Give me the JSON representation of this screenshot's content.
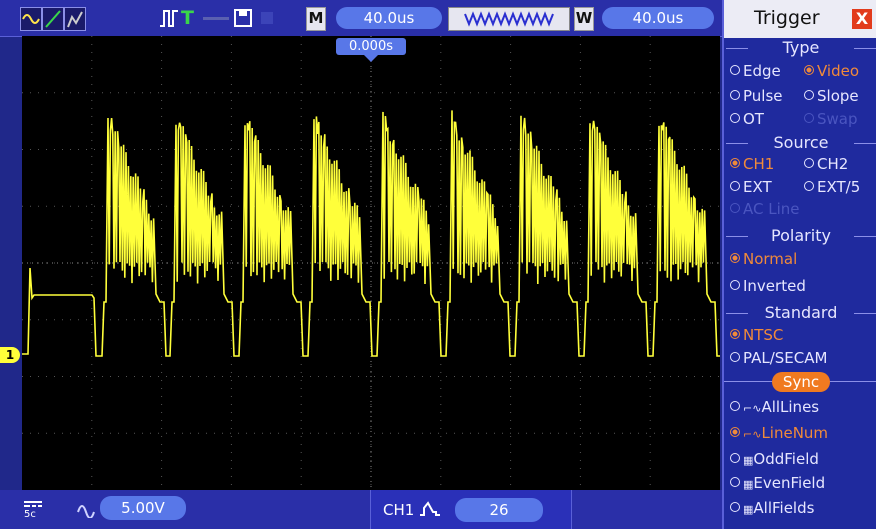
{
  "toolbar": {
    "timebase_label": "M",
    "timebase": "40.0us",
    "window_label": "W",
    "window": "40.0us"
  },
  "screen": {
    "trigger_time": "0.000s",
    "ch1_marker": "1"
  },
  "bottom": {
    "ch_volts": "5.00V",
    "trigger_channel": "CH1",
    "line_number": "26"
  },
  "menu": {
    "title": "Trigger",
    "close": "X",
    "type_title": "Type",
    "type": [
      "Edge",
      "Video",
      "Pulse",
      "Slope",
      "OT",
      "Swap"
    ],
    "source_title": "Source",
    "source": [
      "CH1",
      "CH2",
      "EXT",
      "EXT/5",
      "AC Line"
    ],
    "polarity_title": "Polarity",
    "polarity": [
      "Normal",
      "Inverted"
    ],
    "standard_title": "Standard",
    "standard": [
      "NTSC",
      "PAL/SECAM"
    ],
    "sync_title": "Sync",
    "sync": [
      "AllLines",
      "LineNum",
      "OddField",
      "EvenField",
      "AllFields"
    ]
  },
  "colors": {
    "trace": "#ffff3a",
    "screen": "#000000",
    "menu": "#1f2a9e",
    "selected": "#f08a3a"
  }
}
